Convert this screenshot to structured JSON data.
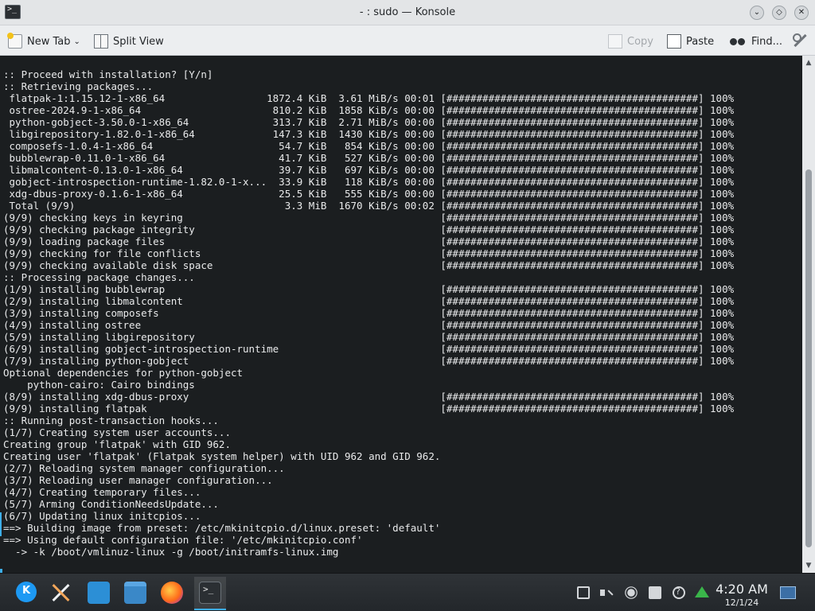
{
  "window": {
    "title": "- : sudo — Konsole"
  },
  "toolbar": {
    "new_tab": "New Tab",
    "split_view": "Split View",
    "copy": "Copy",
    "paste": "Paste",
    "find": "Find..."
  },
  "terminal": {
    "lines": [
      ":: Proceed with installation? [Y/n]",
      ":: Retrieving packages...",
      " flatpak-1:1.15.12-1-x86_64                 1872.4 KiB  3.61 MiB/s 00:01 [##########################################] 100%",
      " ostree-2024.9-1-x86_64                      810.2 KiB  1858 KiB/s 00:00 [##########################################] 100%",
      " python-gobject-3.50.0-1-x86_64              313.7 KiB  2.71 MiB/s 00:00 [##########################################] 100%",
      " libgirepository-1.82.0-1-x86_64             147.3 KiB  1430 KiB/s 00:00 [##########################################] 100%",
      " composefs-1.0.4-1-x86_64                     54.7 KiB   854 KiB/s 00:00 [##########################################] 100%",
      " bubblewrap-0.11.0-1-x86_64                   41.7 KiB   527 KiB/s 00:00 [##########################################] 100%",
      " libmalcontent-0.13.0-1-x86_64                39.7 KiB   697 KiB/s 00:00 [##########################################] 100%",
      " gobject-introspection-runtime-1.82.0-1-x...  33.9 KiB   118 KiB/s 00:00 [##########################################] 100%",
      " xdg-dbus-proxy-0.1.6-1-x86_64                25.5 KiB   555 KiB/s 00:00 [##########################################] 100%",
      " Total (9/9)                                   3.3 MiB  1670 KiB/s 00:02 [##########################################] 100%",
      "(9/9) checking keys in keyring                                           [##########################################] 100%",
      "(9/9) checking package integrity                                         [##########################################] 100%",
      "(9/9) loading package files                                              [##########################################] 100%",
      "(9/9) checking for file conflicts                                        [##########################################] 100%",
      "(9/9) checking available disk space                                      [##########################################] 100%",
      ":: Processing package changes...",
      "(1/9) installing bubblewrap                                              [##########################################] 100%",
      "(2/9) installing libmalcontent                                           [##########################################] 100%",
      "(3/9) installing composefs                                               [##########################################] 100%",
      "(4/9) installing ostree                                                  [##########################################] 100%",
      "(5/9) installing libgirepository                                         [##########################################] 100%",
      "(6/9) installing gobject-introspection-runtime                           [##########################################] 100%",
      "(7/9) installing python-gobject                                          [##########################################] 100%",
      "Optional dependencies for python-gobject",
      "    python-cairo: Cairo bindings",
      "(8/9) installing xdg-dbus-proxy                                          [##########################################] 100%",
      "(9/9) installing flatpak                                                 [##########################################] 100%",
      ":: Running post-transaction hooks...",
      "(1/7) Creating system user accounts...",
      "Creating group 'flatpak' with GID 962.",
      "Creating user 'flatpak' (Flatpak system helper) with UID 962 and GID 962.",
      "(2/7) Reloading system manager configuration...",
      "(3/7) Reloading user manager configuration...",
      "(4/7) Creating temporary files...",
      "(5/7) Arming ConditionNeedsUpdate...",
      "(6/7) Updating linux initcpios...",
      "==> Building image from preset: /etc/mkinitcpio.d/linux.preset: 'default'",
      "==> Using default configuration file: '/etc/mkinitcpio.conf'",
      "  -> -k /boot/vmlinuz-linux -g /boot/initramfs-linux.img"
    ]
  },
  "taskbar": {
    "clock_time": "4:20 AM",
    "clock_date": "12/1/24",
    "icons": [
      "kde-launcher-icon",
      "system-settings-icon",
      "discover-icon",
      "dolphin-icon",
      "firefox-icon",
      "konsole-icon"
    ]
  },
  "colors": {
    "terminal_bg": "#1b1e20",
    "terminal_fg": "#e9eaeb",
    "accent": "#3daee9"
  }
}
